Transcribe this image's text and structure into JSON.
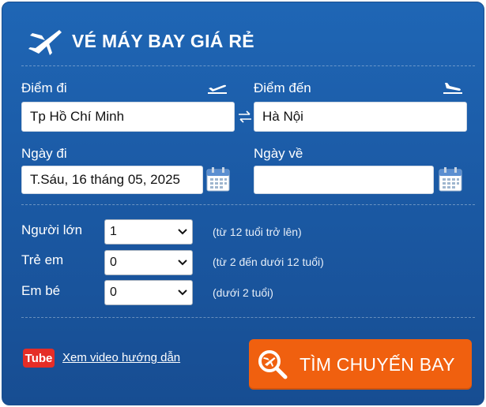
{
  "header": {
    "title": "VÉ MÁY BAY GIÁ RẺ"
  },
  "origin": {
    "label": "Điểm đi",
    "value": "Tp Hồ Chí Minh"
  },
  "destination": {
    "label": "Điểm đến",
    "value": "Hà Nội"
  },
  "depart_date": {
    "label": "Ngày đi",
    "value": "T.Sáu, 16 tháng 05, 2025"
  },
  "return_date": {
    "label": "Ngày về",
    "value": ""
  },
  "passengers": {
    "adults": {
      "label": "Người lớn",
      "value": "1",
      "hint": "(từ 12 tuổi trở lên)"
    },
    "children": {
      "label": "Trẻ em",
      "value": "0",
      "hint": "(từ 2 đến dưới 12 tuổi)"
    },
    "infants": {
      "label": "Em bé",
      "value": "0",
      "hint": "(dưới 2 tuổi)"
    }
  },
  "footer": {
    "youtube_text": "Tube",
    "video_link": "Xem video hướng dẫn",
    "search_label": "TÌM CHUYẾN BAY"
  },
  "colors": {
    "panel": "#1b5aa5",
    "accent": "#f0600f",
    "youtube": "#e52d27"
  }
}
